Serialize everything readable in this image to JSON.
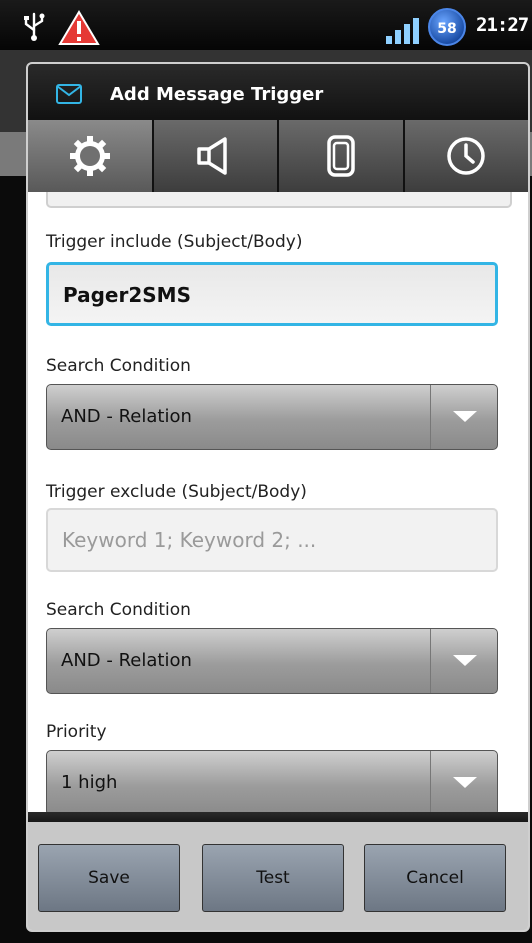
{
  "status_bar": {
    "battery_level": "58",
    "time": "21:27",
    "icons": [
      "usb-icon",
      "warning-icon",
      "signal-icon",
      "battery-icon"
    ]
  },
  "dialog": {
    "title": "Add Message Trigger",
    "title_icon": "mail-icon",
    "tabs": [
      {
        "icon": "gear-icon",
        "active": true
      },
      {
        "icon": "speaker-icon",
        "active": false
      },
      {
        "icon": "phone-icon",
        "active": false
      },
      {
        "icon": "clock-icon",
        "active": false
      }
    ],
    "fields": {
      "trigger_include_label": "Trigger include (Subject/Body)",
      "trigger_include_value": "Pager2SMS",
      "search_condition_1_label": "Search Condition",
      "search_condition_1_value": "AND - Relation",
      "trigger_exclude_label": "Trigger exclude (Subject/Body)",
      "trigger_exclude_placeholder": "Keyword 1; Keyword 2; ...",
      "search_condition_2_label": "Search Condition",
      "search_condition_2_value": "AND - Relation",
      "priority_label": "Priority",
      "priority_value": "1 high"
    },
    "buttons": {
      "save": "Save",
      "test": "Test",
      "cancel": "Cancel"
    }
  },
  "colors": {
    "focus_accent": "#33b5e5",
    "warning": "#e53935",
    "battery": "#1c4fa8"
  }
}
